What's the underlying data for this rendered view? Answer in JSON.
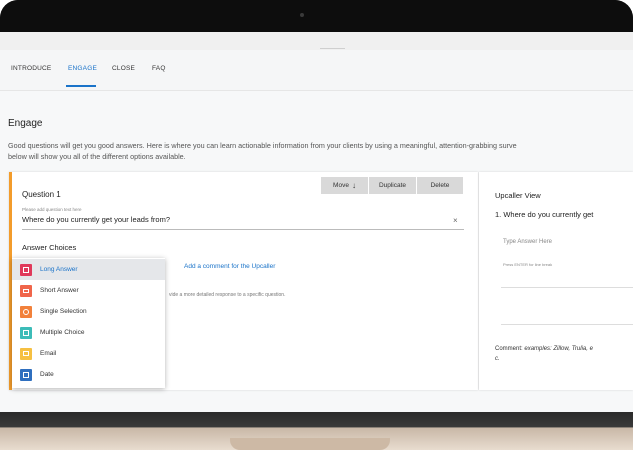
{
  "tabs": [
    {
      "label": "INTRODUCE"
    },
    {
      "label": "ENGAGE"
    },
    {
      "label": "CLOSE"
    },
    {
      "label": "FAQ"
    }
  ],
  "page": {
    "title": "Engage",
    "intro_line1": "Good questions will get you good answers. Here is where you can learn actionable information from your clients by using a meaningful, attention-grabbing surve",
    "intro_line2": "below will show you all of the different options available."
  },
  "question": {
    "title": "Question 1",
    "hint": "Please add question text here",
    "text": "Where do you currently get your leads from?",
    "clear": "×",
    "answer_heading": "Answer Choices",
    "add_comment": "Add a comment for the Upcaller",
    "help_text": "vide a more detailed response to a specific question.",
    "buttons": {
      "move": "Move",
      "move_arrow": "↓",
      "duplicate": "Duplicate",
      "delete": "Delete"
    }
  },
  "answer_types": [
    {
      "label": "Long Answer",
      "color": "#e0395a",
      "icon": "long-answer-icon"
    },
    {
      "label": "Short Answer",
      "color": "#f0654a",
      "icon": "short-answer-icon"
    },
    {
      "label": "Single Selection",
      "color": "#f2813b",
      "icon": "single-selection-icon"
    },
    {
      "label": "Multiple Choice",
      "color": "#3cbcb8",
      "icon": "multiple-choice-icon"
    },
    {
      "label": "Email",
      "color": "#f6c042",
      "icon": "email-icon"
    },
    {
      "label": "Date",
      "color": "#2f6fbf",
      "icon": "date-icon"
    }
  ],
  "selected_answer_type": "Long Answer",
  "upcaller": {
    "title": "Upcaller View",
    "question": "1. Where do you currently get",
    "input_placeholder": "Type Answer Here",
    "input_hint": "Press ENTER for line break",
    "comment_label": "Comment:",
    "comment_text": "examples: Zillow, Trulia, e",
    "comment_tail": "c."
  },
  "colors": {
    "accent": "#1a73c9",
    "card_border": "#f39c2b"
  }
}
